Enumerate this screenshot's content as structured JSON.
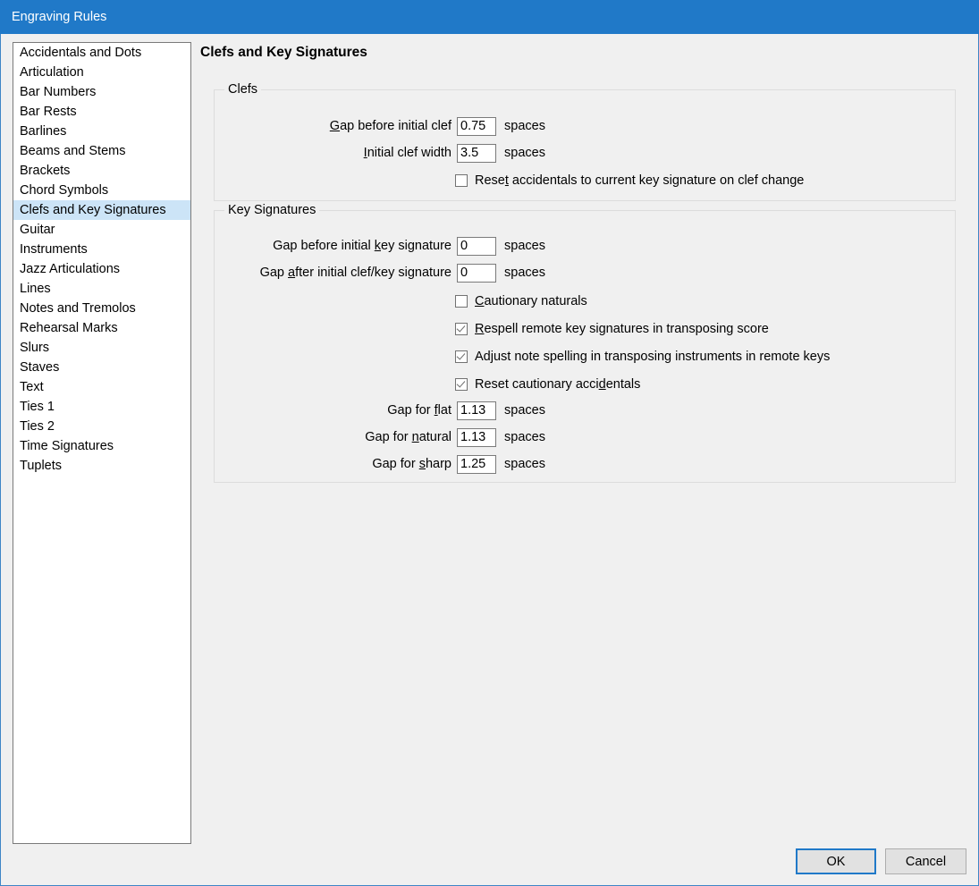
{
  "window": {
    "title": "Engraving Rules"
  },
  "sidebar": {
    "items": [
      {
        "label": "Accidentals and Dots",
        "selected": false
      },
      {
        "label": "Articulation",
        "selected": false
      },
      {
        "label": "Bar Numbers",
        "selected": false
      },
      {
        "label": "Bar Rests",
        "selected": false
      },
      {
        "label": "Barlines",
        "selected": false
      },
      {
        "label": "Beams and Stems",
        "selected": false
      },
      {
        "label": "Brackets",
        "selected": false
      },
      {
        "label": "Chord Symbols",
        "selected": false
      },
      {
        "label": "Clefs and Key Signatures",
        "selected": true
      },
      {
        "label": "Guitar",
        "selected": false
      },
      {
        "label": "Instruments",
        "selected": false
      },
      {
        "label": "Jazz Articulations",
        "selected": false
      },
      {
        "label": "Lines",
        "selected": false
      },
      {
        "label": "Notes and Tremolos",
        "selected": false
      },
      {
        "label": "Rehearsal Marks",
        "selected": false
      },
      {
        "label": "Slurs",
        "selected": false
      },
      {
        "label": "Staves",
        "selected": false
      },
      {
        "label": "Text",
        "selected": false
      },
      {
        "label": "Ties 1",
        "selected": false
      },
      {
        "label": "Ties 2",
        "selected": false
      },
      {
        "label": "Time Signatures",
        "selected": false
      },
      {
        "label": "Tuplets",
        "selected": false
      }
    ]
  },
  "page": {
    "title": "Clefs and Key Signatures",
    "unit_label": "spaces"
  },
  "clefs": {
    "group_label": "Clefs",
    "gap_before_initial_clef": {
      "label_pre": "",
      "label_accel": "G",
      "label_post": "ap before initial clef",
      "value": "0.75",
      "unit": "spaces"
    },
    "initial_clef_width": {
      "label_pre": "",
      "label_accel": "I",
      "label_post": "nitial clef width",
      "value": "3.5",
      "unit": "spaces"
    },
    "reset_accidentals_on_clef_change": {
      "label_pre": "Rese",
      "label_accel": "t",
      "label_post": " accidentals to current key signature on clef change",
      "checked": false
    }
  },
  "key_signatures": {
    "group_label": "Key Signatures",
    "gap_before_initial_key_signature": {
      "label_pre": "Gap before initial ",
      "label_accel": "k",
      "label_post": "ey signature",
      "value": "0",
      "unit": "spaces"
    },
    "gap_after_initial_clef_key_signature": {
      "label_pre": "Gap ",
      "label_accel": "a",
      "label_post": "fter initial clef/key signature",
      "value": "0",
      "unit": "spaces"
    },
    "cautionary_naturals": {
      "label_pre": "",
      "label_accel": "C",
      "label_post": "autionary naturals",
      "checked": false
    },
    "respell_remote_key_signatures": {
      "label_pre": "",
      "label_accel": "R",
      "label_post": "espell remote key signatures in transposing score",
      "checked": true
    },
    "adjust_note_spelling": {
      "label_pre": "Ad",
      "label_accel": "j",
      "label_post": "ust note spelling in transposing instruments in remote keys",
      "checked": true
    },
    "reset_cautionary_accidentals": {
      "label_pre": "Reset cautionary acci",
      "label_accel": "d",
      "label_post": "entals",
      "checked": true
    },
    "gap_for_flat": {
      "label_pre": "Gap for ",
      "label_accel": "f",
      "label_post": "lat",
      "value": "1.13",
      "unit": "spaces"
    },
    "gap_for_natural": {
      "label_pre": "Gap for ",
      "label_accel": "n",
      "label_post": "atural",
      "value": "1.13",
      "unit": "spaces"
    },
    "gap_for_sharp": {
      "label_pre": "Gap for ",
      "label_accel": "s",
      "label_post": "harp",
      "value": "1.25",
      "unit": "spaces"
    }
  },
  "footer": {
    "ok_label": "OK",
    "cancel_label": "Cancel"
  },
  "colors": {
    "titlebar": "#2079c8",
    "selection": "#cce4f7",
    "dialog_bg": "#f0f0f0",
    "accent_border": "#2079c8"
  }
}
